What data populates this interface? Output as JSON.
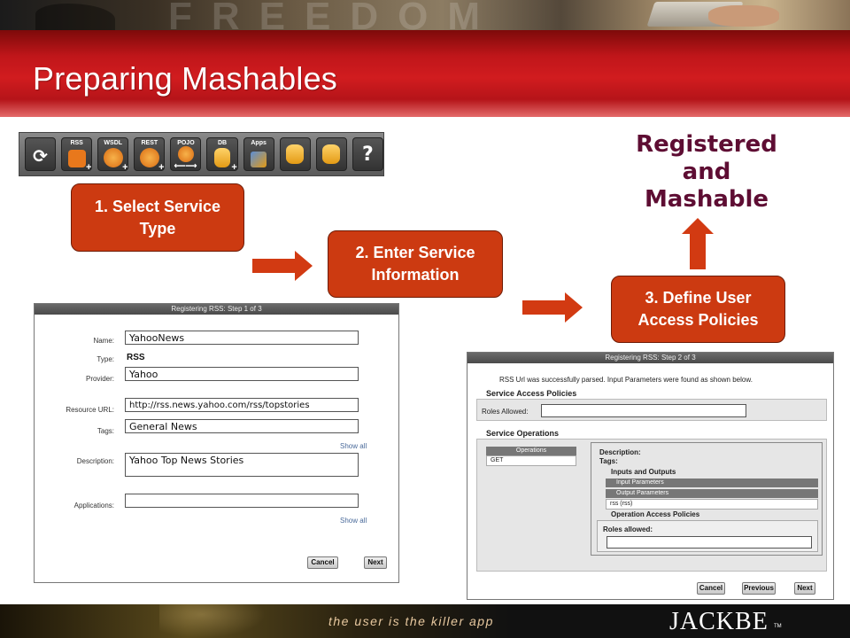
{
  "slide": {
    "title": "Preparing Mashables",
    "tagline": "the user is the killer app",
    "brand": "JACKBE",
    "trademark": "TM"
  },
  "toolbar": {
    "buttons": [
      {
        "label": "",
        "icon": "refresh-icon"
      },
      {
        "label": "RSS",
        "icon": "rss-icon"
      },
      {
        "label": "WSDL",
        "icon": "wsdl-icon"
      },
      {
        "label": "REST",
        "icon": "rest-icon"
      },
      {
        "label": "POJO",
        "icon": "pojo-icon"
      },
      {
        "label": "DB",
        "icon": "database-icon"
      },
      {
        "label": "Apps",
        "icon": "apps-icon"
      },
      {
        "label": "",
        "icon": "db-settings-icon"
      },
      {
        "label": "",
        "icon": "db-check-icon"
      },
      {
        "label": "?",
        "icon": "help-icon"
      }
    ]
  },
  "steps": {
    "step1": "1. Select Service Type",
    "step2": "2. Enter Service Information",
    "step3": "3. Define User Access Policies"
  },
  "result": {
    "line1": "Registered",
    "line2": "and",
    "line3": "Mashable"
  },
  "dialog1": {
    "title": "Registering RSS: Step 1 of 3",
    "name_label": "Name:",
    "name_value": "YahooNews",
    "type_label": "Type:",
    "type_value": "RSS",
    "provider_label": "Provider:",
    "provider_value": "Yahoo",
    "url_label": "Resource URL:",
    "url_value": "http://rss.news.yahoo.com/rss/topstories",
    "tags_label": "Tags:",
    "tags_value": "General News",
    "show_all_1": "Show all",
    "description_label": "Description:",
    "description_value": "Yahoo Top News Stories",
    "applications_label": "Applications:",
    "applications_value": "",
    "show_all_2": "Show all",
    "cancel": "Cancel",
    "next": "Next"
  },
  "dialog2": {
    "title": "Registering RSS: Step 2 of 3",
    "message": "RSS Url was successfully parsed. Input Parameters were found as shown below.",
    "access_policies_heading": "Service Access Policies",
    "roles_allowed_label": "Roles Allowed:",
    "operations_heading": "Service Operations",
    "operations_column": "Operations",
    "operation_get": "GET",
    "description_label": "Description:",
    "tags_label": "Tags:",
    "inputs_outputs": "Inputs and Outputs",
    "input_parameters": "Input Parameters",
    "output_parameters": "Output Parameters",
    "output_value": "rss (rss)",
    "op_access_policies": "Operation Access Policies",
    "roles_allowed_lower": "Roles allowed:",
    "cancel": "Cancel",
    "previous": "Previous",
    "next": "Next"
  },
  "colors": {
    "step_fill": "#cc3a11",
    "arrow": "#d23a12",
    "title_red": "#c0161a",
    "registered_text": "#5e0d33"
  }
}
